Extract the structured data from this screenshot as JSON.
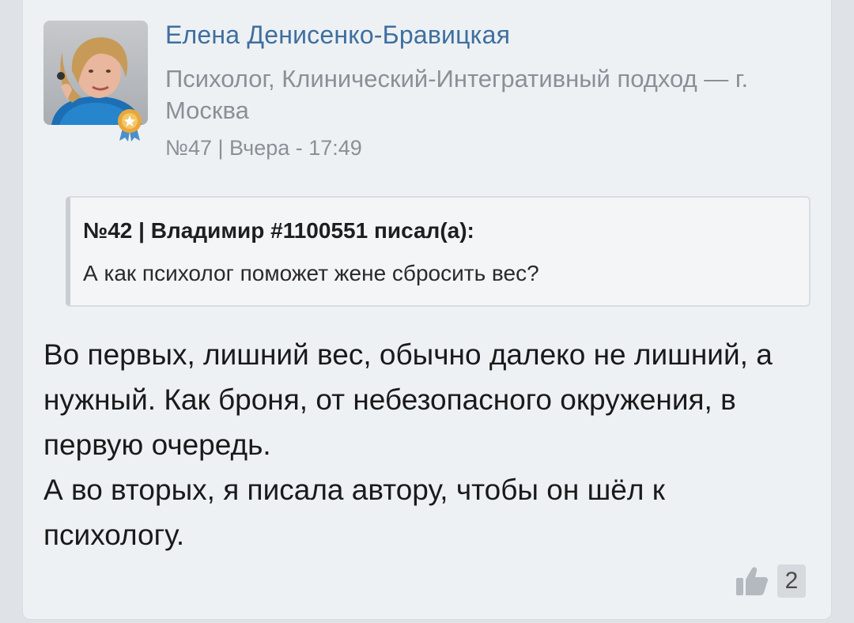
{
  "post": {
    "author": {
      "name": "Елена Денисенко-Бравицкая",
      "info": "Психолог, Клинический-Интегративный подход — г. Москва",
      "avatar_icon": "user-photo-icon",
      "badge_icon": "award-medal-icon"
    },
    "meta": "№47 | Вчера - 17:49",
    "quote": {
      "header": "№42 | Владимир #1100551 писал(а):",
      "text": "А как психолог поможет жене сбросить вес?"
    },
    "body": {
      "paragraph1": "Во первых, лишний вес, обычно далеко не лишний, а нужный. Как броня, от небезопасного окружения, в первую очередь.",
      "paragraph2": "А во вторых, я писала автору, чтобы он шёл к психологу."
    },
    "likes": {
      "icon": "thumbs-up-icon",
      "count": "2"
    }
  },
  "colors": {
    "author_link": "#3f6f9f",
    "muted_text": "#8a9097",
    "card_bg": "#eef1f4",
    "quote_bg": "#f4f5f7"
  }
}
